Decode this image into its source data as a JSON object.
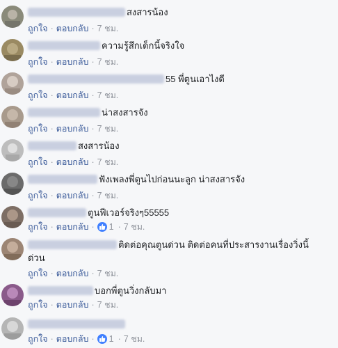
{
  "labels": {
    "like": "ถูกใจ",
    "reply": "ตอบกลับ",
    "dot": "·"
  },
  "comments": [
    {
      "text": "สงสารน้อง",
      "time": "7 ชม.",
      "avatar_color": "#8a8a7a"
    },
    {
      "text": "ความรู้สึกเด็กนี้จริงใจ",
      "time": "7 ชม.",
      "avatar_color": "#9a8a62"
    },
    {
      "text": "55 พี่ตูนเอาไงดี",
      "time": "7 ชม.",
      "avatar_color": "#b0a39a"
    },
    {
      "text": "น่าสงสารจัง",
      "time": "7 ชม.",
      "avatar_color": "#a89a8c"
    },
    {
      "text": "สงสารน้อง",
      "time": "7 ชม.",
      "avatar_color": "#bdbdbd"
    },
    {
      "text": "ฟังเพลงพี่ตูนไปก่อนนะลูก น่าสงสารจัง",
      "time": "7 ชม.",
      "avatar_color": "#6b6b6b"
    },
    {
      "text": "ตูนฟีเวอร์จริงๆ55555",
      "time": "7 ชม.",
      "likes": "1",
      "avatar_color": "#7d6e64"
    },
    {
      "text": "ติดต่อคุณตูนด่วน ติดต่อคนที่ประสารงานเรื่องวิ่งนี้ด่วน",
      "time": "7 ชม.",
      "avatar_color": "#9c8574"
    },
    {
      "text": "บอกพี่ตูนวิ่งกลับมา",
      "time": "7 ชม.",
      "avatar_color": "#8a5a8a"
    },
    {
      "text": "",
      "time": "7 ชม.",
      "likes": "1",
      "avatar_color": "#b5b5b5"
    }
  ]
}
